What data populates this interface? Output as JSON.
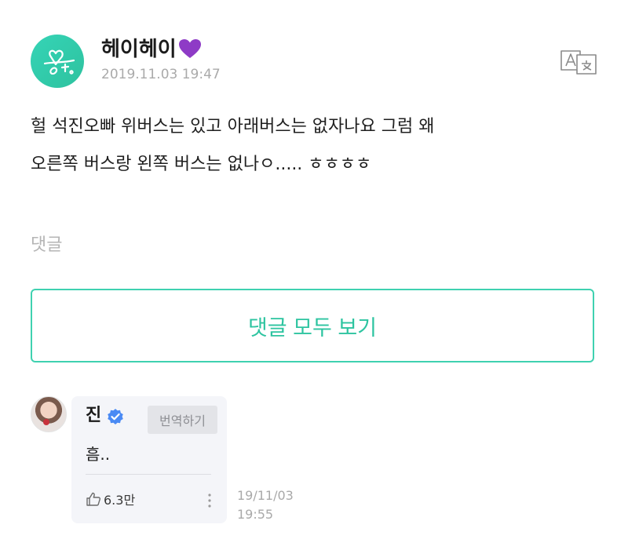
{
  "post": {
    "author_name": "헤이헤이",
    "timestamp": "2019.11.03 19:47",
    "body_lines": [
      "헐 석진오빠 위버스는 있고 아래버스는 없자나요 그럼 왜",
      "오른쪽 버스랑 왼쪽 버스는 없나ㅇ..... ㅎㅎㅎㅎ"
    ],
    "icons": {
      "author_badge": "purple-heart",
      "translate": "translate-icon"
    }
  },
  "comments_section": {
    "label": "댓글",
    "view_all_label": "댓글 모두 보기"
  },
  "comment": {
    "author_name": "진",
    "translate_label": "번역하기",
    "text": "흠..",
    "like_count": "6.3만",
    "date": "19/11/03",
    "time": "19:55",
    "icons": {
      "verified": "verified-badge",
      "like": "thumbs-up",
      "more": "vertical-ellipsis"
    }
  },
  "colors": {
    "accent": "#2dc4a0",
    "verified": "#4a8af4",
    "heart": "#8e3bc6",
    "muted": "#aaaaaa"
  }
}
